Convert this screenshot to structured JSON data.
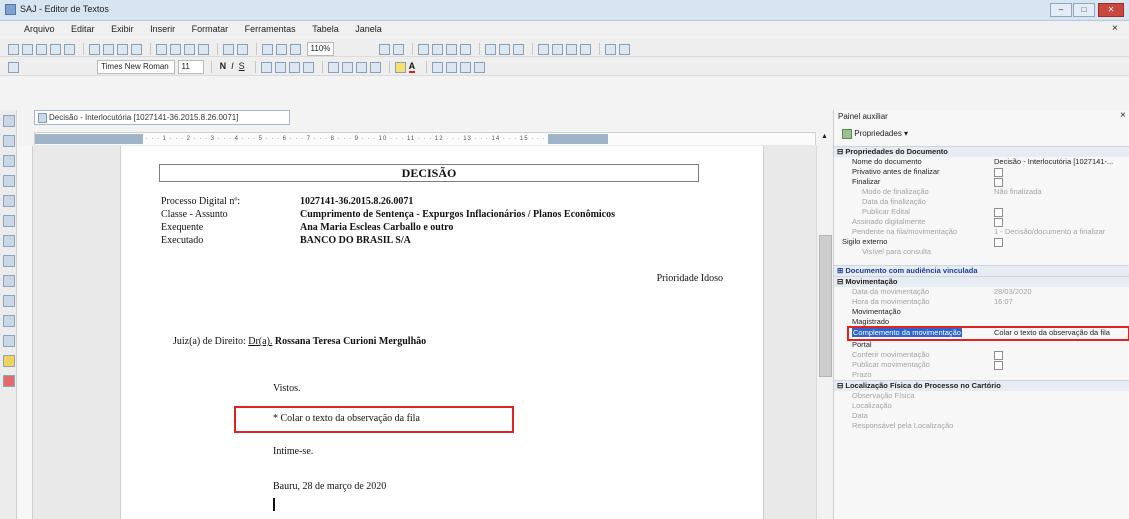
{
  "window": {
    "title": "SAJ - Editor de Textos"
  },
  "menu": [
    "Arquivo",
    "Editar",
    "Exibir",
    "Inserir",
    "Formatar",
    "Ferramentas",
    "Tabela",
    "Janela"
  ],
  "toolbar": {
    "zoom": "110%",
    "font_label": "Times New Roman",
    "font_size": "11"
  },
  "document_tab": {
    "label": "Decisão - Interlocutória [1027141-36.2015.8.26.0071]"
  },
  "document": {
    "heading": "DECISÃO",
    "fields": [
      {
        "label": "Processo Digital nº:",
        "value": "1027141-36.2015.8.26.0071"
      },
      {
        "label": "Classe - Assunto",
        "value": "Cumprimento de Sentença - Expurgos Inflacionários / Planos Econômicos"
      },
      {
        "label": "Exequente",
        "value": "Ana Maria Escleas Carballo e outro"
      },
      {
        "label": "Executado",
        "value": "BANCO DO BRASIL S/A"
      }
    ],
    "priority": "Prioridade Idoso",
    "judge_prefix": "Juiz(a) de Direito:",
    "judge_title": "Dr(a).",
    "judge_name": "Rossana Teresa Curioni Mergulhão",
    "vistos": "Vistos.",
    "paste_note": "* Colar o texto da observação da fila",
    "intime": "Intime-se.",
    "date_line": "Bauru, 28 de março de 2020"
  },
  "panel": {
    "title": "Painel auxiliar",
    "properties_button": "Propriedades",
    "sections": [
      {
        "title": "Propriedades do Documento",
        "rows": [
          {
            "k": "Nome do documento",
            "v": "Decisão - Interlocutória [1027141-...",
            "dim": false
          },
          {
            "k": "Privativo antes de finalizar",
            "v": "",
            "check": true,
            "dim": false
          },
          {
            "k": "Finalizar",
            "v": "",
            "check": true,
            "dim": false
          },
          {
            "k": "Modo de finalização",
            "v": "Não finalizada",
            "dim": true
          },
          {
            "k": "Data da finalização",
            "v": "",
            "dim": true
          },
          {
            "k": "Publicar Edital",
            "v": "",
            "check": true,
            "dim": true
          },
          {
            "k": "Assinado digitalmente",
            "v": "",
            "check": true,
            "dim": true
          },
          {
            "k": "Pendente na fila/movimentação",
            "v": "1 - Decisão/documento a finalizar",
            "dim": true
          },
          {
            "k": "Sigilo externo",
            "v": "",
            "check": true,
            "dim": false
          },
          {
            "k": "Visível para consulta",
            "v": "",
            "dim": true
          }
        ]
      },
      {
        "title": "Documento com audiência vinculada",
        "blue": true,
        "rows": []
      },
      {
        "title": "Movimentação",
        "rows": [
          {
            "k": "Data da movimentação",
            "v": "28/03/2020",
            "dim": true
          },
          {
            "k": "Hora da movimentação",
            "v": "16:07",
            "dim": true
          },
          {
            "k": "Movimentação",
            "v": "",
            "dim": false
          },
          {
            "k": "Magistrado",
            "v": "",
            "dim": false
          },
          {
            "k": "Complemento da movimentação",
            "v": "Colar o texto da observação da fila",
            "selected": true,
            "dim": false
          },
          {
            "k": "Portal",
            "v": "",
            "dim": false
          },
          {
            "k": "Conferir movimentação",
            "v": "",
            "check": true,
            "dim": true
          },
          {
            "k": "Publicar movimentação",
            "v": "",
            "check": true,
            "dim": true
          },
          {
            "k": "Prazo",
            "v": "",
            "dim": true
          }
        ]
      },
      {
        "title": "Localização Física do Processo no Cartório",
        "rows": [
          {
            "k": "Observação Física",
            "v": "",
            "dim": true
          },
          {
            "k": "Localização",
            "v": "",
            "dim": true
          },
          {
            "k": "Data",
            "v": "",
            "dim": true
          },
          {
            "k": "Responsável pela Localização",
            "v": "",
            "dim": true
          }
        ]
      }
    ]
  }
}
